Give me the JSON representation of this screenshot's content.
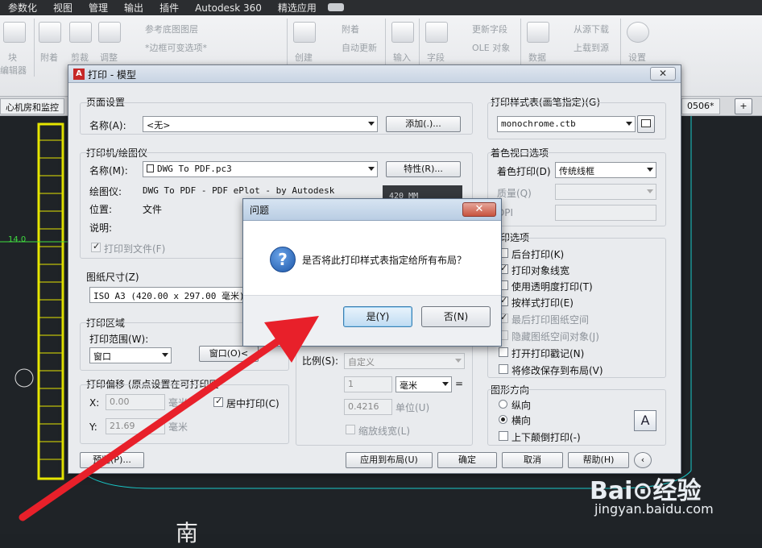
{
  "menu": [
    "参数化",
    "视图",
    "管理",
    "输出",
    "插件",
    "Autodesk 360",
    "精选应用"
  ],
  "ribbon": {
    "panel_block": [
      "块",
      "编辑器"
    ],
    "attach": "附着",
    "clip": "剪裁",
    "adjust": "调整",
    "underlay_layer": "参考底图图层",
    "frame_variable": "*边框可变选项*",
    "create": "创建",
    "attach2": "附着",
    "autoupdate": "自动更新",
    "input": "输入",
    "field": "字段",
    "update_field": "更新字段",
    "ole": "OLE 对象",
    "data": "数据",
    "download_from_source": "从源下载",
    "upload_to_source": "上载到源",
    "settings": "设置"
  },
  "drawing_tabs": [
    "心机房和监控"
  ],
  "drawing_tab_right": "0506*",
  "canvas_label": "14.0",
  "canvas_glyph": "南",
  "plot_dialog": {
    "title": "打印 - 模型",
    "page_setup": {
      "section": "页面设置",
      "name_label": "名称(A):",
      "name_value": "<无>",
      "add_button": "添加(.)..."
    },
    "printer": {
      "section": "打印机/绘图仪",
      "name_label": "名称(M):",
      "name_value": "DWG To PDF.pc3",
      "properties_button": "特性(R)...",
      "plotter_label": "绘图仪:",
      "plotter_value": "DWG To PDF - PDF ePlot - by Autodesk",
      "where_label": "位置:",
      "where_value": "文件",
      "description_label": "说明:",
      "plot_to_file": "打印到文件(F)",
      "preview_text": "420 MM"
    },
    "paper_size": {
      "section": "图纸尺寸(Z)",
      "value": "ISO A3 (420.00 x 297.00 毫米)"
    },
    "plot_area": {
      "section": "打印区域",
      "range_label": "打印范围(W):",
      "range_value": "窗口",
      "window_button": "窗口(O)<"
    },
    "plot_offset": {
      "section": "打印偏移 (原点设置在可打印区",
      "x_label": "X:",
      "x_value": "0.00",
      "x_unit": "毫米",
      "y_label": "Y:",
      "y_value": "21.69",
      "y_unit": "毫米",
      "center_plot": "居中打印(C)"
    },
    "plot_scale": {
      "scale_label": "比例(S):",
      "scale_value": "自定义",
      "value1": "1",
      "unit_combo": "毫米",
      "equals": "=",
      "value2": "0.4216",
      "unit_label": "单位(U)",
      "scale_lineweights": "缩放线宽(L)"
    },
    "plot_style_table": {
      "section": "打印样式表(画笔指定)(G)",
      "value": "monochrome.ctb"
    },
    "shaded_viewport": {
      "section": "着色视口选项",
      "shade_label": "着色打印(D)",
      "shade_value": "传统线框",
      "quality_label": "质量(Q)",
      "dpi_label": "DPI"
    },
    "plot_options": {
      "section": "打印选项",
      "items": [
        {
          "label": "后台打印(K)",
          "checked": false,
          "disabled": false
        },
        {
          "label": "打印对象线宽",
          "checked": true,
          "disabled": false
        },
        {
          "label": "使用透明度打印(T)",
          "checked": false,
          "disabled": false
        },
        {
          "label": "按样式打印(E)",
          "checked": true,
          "disabled": false
        },
        {
          "label": "最后打印图纸空间",
          "checked": true,
          "disabled": true
        },
        {
          "label": "隐藏图纸空间对象(J)",
          "checked": false,
          "disabled": true
        },
        {
          "label": "打开打印戳记(N)",
          "checked": false,
          "disabled": false
        },
        {
          "label": "将修改保存到布局(V)",
          "checked": false,
          "disabled": false
        }
      ]
    },
    "orientation": {
      "section": "图形方向",
      "portrait": "纵向",
      "landscape": "横向",
      "selected": "横向",
      "upside_down": "上下颠倒打印(-)",
      "icon_letter": "A"
    },
    "footer": {
      "preview": "预览(P)...",
      "apply_to_layout": "应用到布局(U)",
      "ok": "确定",
      "cancel": "取消",
      "help": "帮助(H)"
    }
  },
  "question_dialog": {
    "title": "问题",
    "message": "是否将此打印样式表指定给所有布局？",
    "yes": "是(Y)",
    "no": "否(N)",
    "icon_glyph": "?"
  },
  "watermark": {
    "logo": "Bai⊙经验",
    "url": "jingyan.baidu.com"
  },
  "colors": {
    "arrow": "#e8202a",
    "yellow_frame": "#e6e600",
    "cyan_line": "#19c9c9",
    "green_text": "#3fdc3f"
  }
}
